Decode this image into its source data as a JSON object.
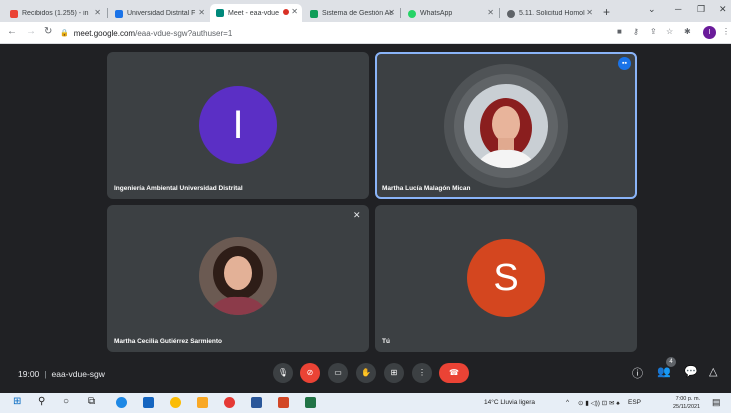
{
  "browser": {
    "tabs": [
      {
        "label": "Recibidos (1.255) - in",
        "favicon": "gmail-icon",
        "color": "#ea4335"
      },
      {
        "label": "Universidad Distrital F",
        "favicon": "site-icon",
        "color": "#1a73e8"
      },
      {
        "label": "Meet - eaa-vdue",
        "favicon": "meet-icon",
        "color": "#00897b"
      },
      {
        "label": "Sistema de Gestión Ac",
        "favicon": "site-icon",
        "color": "#0f9d58"
      },
      {
        "label": "WhatsApp",
        "favicon": "whatsapp-icon",
        "color": "#25d366"
      },
      {
        "label": "5.11. Solicitud Homol",
        "favicon": "site-icon",
        "color": "#5f6368"
      }
    ],
    "url_host": "meet.google.com",
    "url_path": "/eaa-vdue-sgw?authuser=1",
    "profile_initial": "I"
  },
  "meeting": {
    "time": "19:00",
    "code": "eaa-vdue-sgw",
    "participant_count": "4",
    "tiles": [
      {
        "name": "Ingeniería Ambiental Universidad Distrital",
        "initial": "I",
        "avatar_color": "#5b2fc5"
      },
      {
        "name": "Martha Lucía Malagón Mican"
      },
      {
        "name": "Martha Cecilia Gutiérrez Sarmiento"
      },
      {
        "name": "Tú",
        "initial": "S",
        "avatar_color": "#d4461f"
      }
    ]
  },
  "taskbar": {
    "weather": "14°C  Lluvia ligera",
    "lang": "ESP",
    "time": "7:00 p. m.",
    "date": "25/11/2021"
  }
}
